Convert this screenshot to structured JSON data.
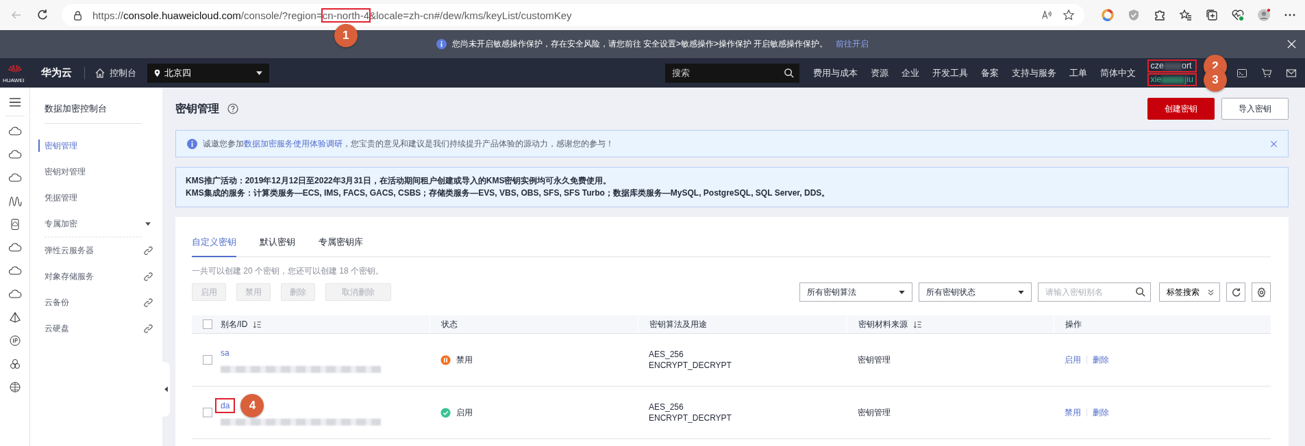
{
  "browser": {
    "url": [
      {
        "text": "https://",
        "kind": "muted"
      },
      {
        "text": "console.huaweicloud.com",
        "kind": "host"
      },
      {
        "text": "/console/?region=",
        "kind": "muted"
      },
      {
        "text": "cn-north-4",
        "kind": "muted",
        "callout": "1"
      },
      {
        "text": "&locale=zh-cn#/dew/kms/keyList/customKey",
        "kind": "muted"
      }
    ]
  },
  "notice": {
    "text": "您尚未开启敏感操作保护，存在安全风险，请您前往 安全设置>敏感操作>操作保护 开启敏感操作保护。",
    "link": "前往开启"
  },
  "topnav": {
    "logo_text": "HUAWEI",
    "brand": "华为云",
    "console": "控制台",
    "region": "北京四",
    "search_placeholder": "搜索",
    "links": [
      "费用与成本",
      "资源",
      "企业",
      "开发工具",
      "备案",
      "支持与服务",
      "工单",
      "简体中文"
    ],
    "account": {
      "prefix": "cze",
      "suffix": "ort",
      "callout": "2"
    },
    "user": {
      "prefix": "xie",
      "suffix": "jiu",
      "callout": "3"
    }
  },
  "sidebar": {
    "title": "数据加密控制台",
    "items": [
      {
        "label": "密钥管理",
        "kind": "page",
        "selected": true
      },
      {
        "label": "密钥对管理",
        "kind": "page",
        "selected": false
      },
      {
        "label": "凭据管理",
        "kind": "page",
        "selected": false
      },
      {
        "label": "专属加密",
        "kind": "group",
        "selected": false
      },
      {
        "label": "弹性云服务器",
        "kind": "link",
        "selected": false
      },
      {
        "label": "对象存储服务",
        "kind": "link",
        "selected": false
      },
      {
        "label": "云备份",
        "kind": "link",
        "selected": false
      },
      {
        "label": "云硬盘",
        "kind": "link",
        "selected": false
      }
    ]
  },
  "page": {
    "title": "密钥管理",
    "buttons": [
      {
        "label": "创建密钥",
        "kind": "primary"
      },
      {
        "label": "导入密钥",
        "kind": "default"
      }
    ]
  },
  "survey_banner": {
    "before": "诚邀您参加",
    "link": "数据加密服务使用体验调研",
    "after": "，您宝贵的意见和建议是我们持续提升产品体验的源动力，感谢您的参与！"
  },
  "promo": {
    "lines": [
      "KMS推广活动：2019年12月12日至2022年3月31日，在活动期间租户创建或导入的KMS密钥实例均可永久免费使用。",
      "KMS集成的服务：计算类服务—ECS, IMS, FACS, GACS, CSBS；存储类服务—EVS, VBS, OBS, SFS, SFS Turbo；数据库类服务—MySQL, PostgreSQL, SQL Server, DDS。"
    ]
  },
  "tabs": [
    {
      "label": "自定义密钥",
      "selected": true
    },
    {
      "label": "默认密钥",
      "selected": false
    },
    {
      "label": "专属密钥库",
      "selected": false
    }
  ],
  "quota": "一共可以创建 20 个密钥，您还可以创建 18 个密钥。",
  "actions": [
    {
      "label": "启用",
      "disabled": true
    },
    {
      "label": "禁用",
      "disabled": true
    },
    {
      "label": "删除",
      "disabled": true
    },
    {
      "label": "取消删除",
      "disabled": true
    }
  ],
  "filters": {
    "algorithm": "所有密钥算法",
    "status": "所有密钥状态",
    "search_placeholder": "请输入密钥别名",
    "tag_search": "标签搜索"
  },
  "table": {
    "header_checked": false,
    "columns": [
      {
        "label": "别名/ID",
        "sortable": true
      },
      {
        "label": "状态",
        "sortable": false
      },
      {
        "label": "密钥算法及用途",
        "sortable": false
      },
      {
        "label": "密钥材料来源",
        "sortable": true
      },
      {
        "label": "操作",
        "sortable": false
      }
    ],
    "rows": [
      {
        "checked": false,
        "alias": "sa",
        "status": "禁用",
        "kind": "disabled",
        "algorithm": "AES_256",
        "usage": "ENCRYPT_DECRYPT",
        "source": "密钥管理",
        "actions": [
          "启用",
          "删除"
        ]
      },
      {
        "checked": false,
        "alias": "da",
        "callout": "4",
        "status": "启用",
        "kind": "enabled",
        "algorithm": "AES_256",
        "usage": "ENCRYPT_DECRYPT",
        "source": "密钥管理",
        "actions": [
          "禁用",
          "删除"
        ]
      }
    ]
  }
}
